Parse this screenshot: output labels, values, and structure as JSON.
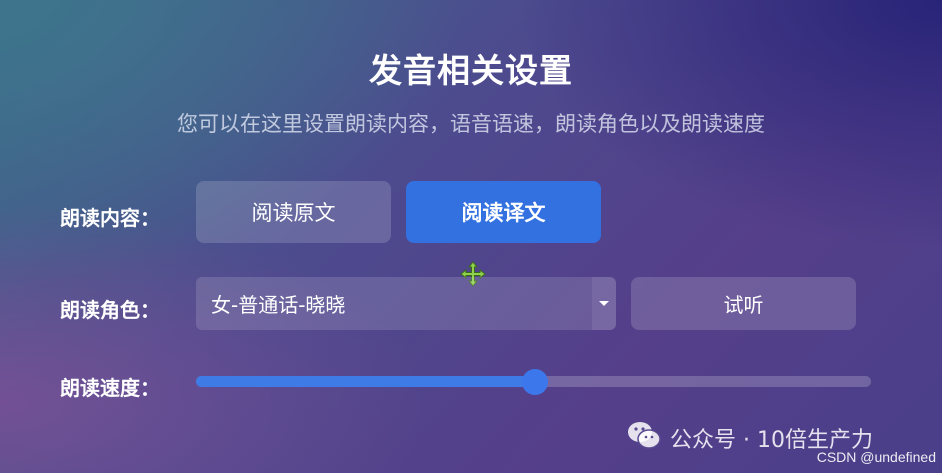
{
  "header": {
    "title": "发音相关设置",
    "subtitle": "您可以在这里设置朗读内容，语音语速，朗读角色以及朗读速度"
  },
  "content_row": {
    "label": "朗读内容：",
    "options": [
      "阅读原文",
      "阅读译文"
    ],
    "selected": "阅读译文"
  },
  "voice_row": {
    "label": "朗读角色：",
    "select_value": "女-普通话-晓晓",
    "preview_label": "试听"
  },
  "speed_row": {
    "label": "朗读速度：",
    "value_fraction": 0.502
  },
  "watermark": {
    "icon": "wechat-icon",
    "text": "公众号 · 10倍生产力"
  },
  "footer": {
    "credit": "CSDN @undefined"
  },
  "colors": {
    "primary": "#3371e0",
    "slider_fill": "#3f7be6",
    "cursor": "#8fd14f"
  },
  "cursor": {
    "icon": "move-cursor-icon"
  }
}
